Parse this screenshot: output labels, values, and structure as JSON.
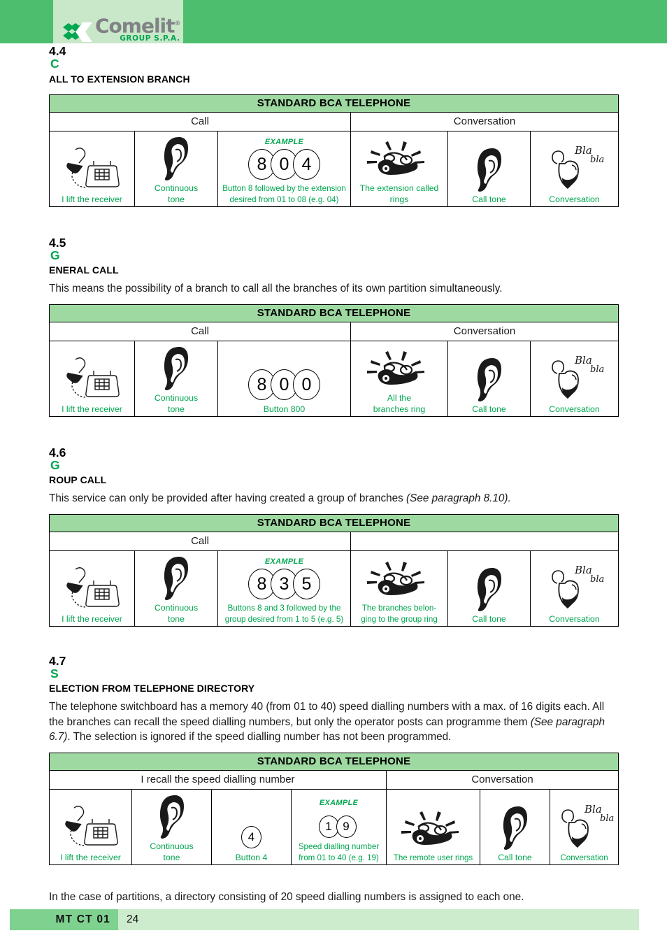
{
  "header": {
    "logo_word": "Comelit",
    "logo_registered": "®",
    "logo_sub": "GROUP S.P.A."
  },
  "sections": [
    {
      "number": "4.4",
      "title_first": "C",
      "title_rest": "ALL TO EXTENSION BRANCH",
      "body": null
    },
    {
      "number": "4.5",
      "title_first": "G",
      "title_rest": "ENERAL CALL",
      "body": "This means the possibility of a branch to call all the branches of its own partition simultaneously."
    },
    {
      "number": "4.6",
      "title_first": "G",
      "title_rest": "ROUP CALL",
      "body_plain": "This service can only be provided after having created a group of branches ",
      "body_italic": "(See paragraph 8.10)."
    },
    {
      "number": "4.7",
      "title_first": "S",
      "title_rest": "ELECTION FROM TELEPHONE DIRECTORY",
      "body_line1": "The telephone switchboard has a memory 40 (from 01 to 40) speed dialling numbers with a max. of 16 digits",
      "body_line2": "each. All the branches can recall the speed dialling numbers, but only the operator posts can programme them",
      "body_italic": "(See paragraph 6.7)",
      "body_line3": ". The selection is ignored if the speed dialling number has not been programmed."
    }
  ],
  "tables": [
    {
      "title": "STANDARD BCA TELEPHONE",
      "group_left": "Call",
      "group_right": "Conversation",
      "cells": [
        {
          "icon": "hand-lifts-receiver-icon",
          "caption": "I lift the receiver"
        },
        {
          "icon": "ear-icon",
          "caption_line1": "Continuous",
          "caption_line2": "tone"
        },
        {
          "icon": "digits",
          "example": "EXAMPLE",
          "digits": [
            "8",
            "0",
            "4"
          ],
          "caption_line1": "Button 8 followed by the extension",
          "caption_line2": "desired from 01 to 08 (e.g. 04)"
        },
        {
          "icon": "ringing-phone-icon",
          "caption_line1": "The extension called",
          "caption_line2": "rings"
        },
        {
          "icon": "ear-icon",
          "caption": "Call tone"
        },
        {
          "icon": "conversation-bla-icon",
          "caption": "Conversation"
        }
      ]
    },
    {
      "title": "STANDARD BCA TELEPHONE",
      "group_left": "Call",
      "group_right": "Conversation",
      "cells": [
        {
          "icon": "hand-lifts-receiver-icon",
          "caption": "I lift the receiver"
        },
        {
          "icon": "ear-icon",
          "caption_line1": "Continuous",
          "caption_line2": "tone"
        },
        {
          "icon": "digits",
          "example": "",
          "digits": [
            "8",
            "0",
            "0"
          ],
          "caption": "Button 800"
        },
        {
          "icon": "ringing-phone-icon",
          "caption_line1": "All the",
          "caption_line2": "branches ring"
        },
        {
          "icon": "ear-icon",
          "caption": "Call tone"
        },
        {
          "icon": "conversation-bla-icon",
          "caption": "Conversation"
        }
      ]
    },
    {
      "title": "STANDARD BCA TELEPHONE",
      "group_left": "Call",
      "group_right": "",
      "cells": [
        {
          "icon": "hand-lifts-receiver-icon",
          "caption": "I lift the receiver"
        },
        {
          "icon": "ear-icon",
          "caption_line1": "Continuous",
          "caption_line2": "tone"
        },
        {
          "icon": "digits",
          "example": "EXAMPLE",
          "digits": [
            "8",
            "3",
            "5"
          ],
          "caption_line1": "Buttons 8 and 3 followed by the",
          "caption_line2": "group desired from 1 to 5 (e.g. 5)"
        },
        {
          "icon": "ringing-phone-icon",
          "caption_line1": "The branches belon-",
          "caption_line2": "ging to the group ring"
        },
        {
          "icon": "ear-icon",
          "caption": "Call tone"
        },
        {
          "icon": "conversation-bla-icon",
          "caption": "Conversation"
        }
      ]
    },
    {
      "title": "STANDARD BCA TELEPHONE",
      "group_left": "I recall the speed dialling number",
      "group_right": "Conversation",
      "cells": [
        {
          "icon": "hand-lifts-receiver-icon",
          "caption": "I lift the receiver"
        },
        {
          "icon": "ear-icon",
          "caption_line1": "Continuous",
          "caption_line2": "tone"
        },
        {
          "icon": "digits",
          "example": "",
          "digits": [
            "4"
          ],
          "caption": "Button 4"
        },
        {
          "icon": "digits",
          "example": "EXAMPLE",
          "digits": [
            "1",
            "9"
          ],
          "caption_line1": "Speed dialling number",
          "caption_line2": "from 01 to 40 (e.g. 19)"
        },
        {
          "icon": "ringing-phone-icon",
          "caption": "The remote user rings"
        },
        {
          "icon": "ear-icon",
          "caption": "Call tone"
        },
        {
          "icon": "conversation-bla-icon",
          "caption": "Conversation"
        }
      ]
    }
  ],
  "closing_paragraph": "In the case of partitions, a directory consisting of 20 speed dialling numbers is assigned to each one.",
  "footer": {
    "code": "MT CT 01",
    "page": "24"
  },
  "colors": {
    "header_green": "#4cbe6e",
    "logo_plate_green": "#c9e7c9",
    "table_header_green": "#9ed9a1",
    "caption_green": "#00a650",
    "footer_light": "#cdeccd",
    "footer_code": "#7fd190"
  }
}
